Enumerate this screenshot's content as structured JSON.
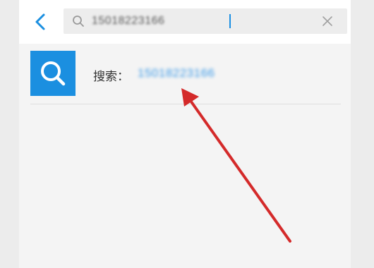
{
  "search": {
    "query": "15018223166",
    "placeholder": ""
  },
  "result": {
    "prefix": "搜索：",
    "number": "15018223166"
  },
  "icons": {
    "back": "chevron-left-icon",
    "search_small": "search-icon",
    "clear": "close-icon",
    "result": "search-icon"
  },
  "colors": {
    "accent": "#1b8fe0",
    "number": "#3d9be8",
    "annotation_arrow": "#d42a2a"
  }
}
